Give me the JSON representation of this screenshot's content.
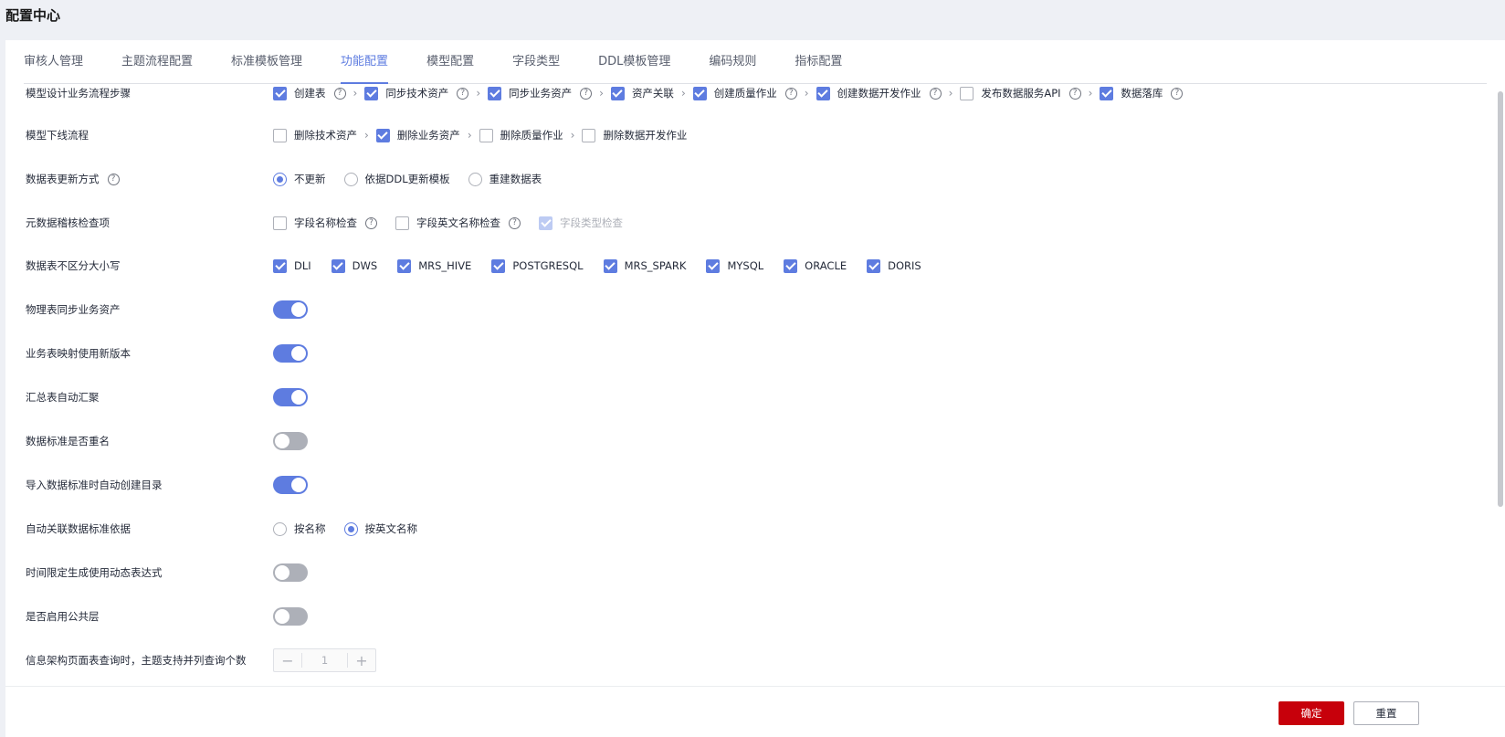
{
  "page_title": "配置中心",
  "tabs": [
    {
      "label": "审核人管理",
      "active": false
    },
    {
      "label": "主题流程配置",
      "active": false
    },
    {
      "label": "标准模板管理",
      "active": false
    },
    {
      "label": "功能配置",
      "active": true
    },
    {
      "label": "模型配置",
      "active": false
    },
    {
      "label": "字段类型",
      "active": false
    },
    {
      "label": "DDL模板管理",
      "active": false
    },
    {
      "label": "编码规则",
      "active": false
    },
    {
      "label": "指标配置",
      "active": false
    }
  ],
  "settings": {
    "model_design_steps": {
      "label": "模型设计业务流程步骤",
      "options": [
        {
          "label": "创建表",
          "checked": true
        },
        {
          "label": "同步技术资产",
          "checked": true
        },
        {
          "label": "同步业务资产",
          "checked": true
        },
        {
          "label": "资产关联",
          "checked": true
        },
        {
          "label": "创建质量作业",
          "checked": true
        },
        {
          "label": "创建数据开发作业",
          "checked": true
        },
        {
          "label": "发布数据服务API",
          "checked": false
        },
        {
          "label": "数据落库",
          "checked": true
        }
      ]
    },
    "model_offline_flow": {
      "label": "模型下线流程",
      "options": [
        {
          "label": "删除技术资产",
          "checked": false
        },
        {
          "label": "删除业务资产",
          "checked": true
        },
        {
          "label": "删除质量作业",
          "checked": false
        },
        {
          "label": "删除数据开发作业",
          "checked": false
        }
      ]
    },
    "table_update_mode": {
      "label": "数据表更新方式",
      "options": [
        {
          "label": "不更新",
          "selected": true
        },
        {
          "label": "依据DDL更新模板",
          "selected": false
        },
        {
          "label": "重建数据表",
          "selected": false
        }
      ]
    },
    "metadata_audit": {
      "label": "元数据稽核检查项",
      "options": [
        {
          "label": "字段名称检查",
          "checked": false
        },
        {
          "label": "字段英文名称检查",
          "checked": false
        },
        {
          "label": "字段类型检查",
          "checked": true,
          "disabled": true
        }
      ]
    },
    "case_insensitive": {
      "label": "数据表不区分大小写",
      "options": [
        {
          "label": "DLI",
          "checked": true
        },
        {
          "label": "DWS",
          "checked": true
        },
        {
          "label": "MRS_HIVE",
          "checked": true
        },
        {
          "label": "POSTGRESQL",
          "checked": true
        },
        {
          "label": "MRS_SPARK",
          "checked": true
        },
        {
          "label": "MYSQL",
          "checked": true
        },
        {
          "label": "ORACLE",
          "checked": true
        },
        {
          "label": "DORIS",
          "checked": true
        }
      ]
    },
    "sync_physical": {
      "label": "物理表同步业务资产",
      "on": true
    },
    "new_mapping": {
      "label": "业务表映射使用新版本",
      "on": true
    },
    "auto_aggregate": {
      "label": "汇总表自动汇聚",
      "on": true
    },
    "standard_rename": {
      "label": "数据标准是否重名",
      "on": false
    },
    "auto_catalog": {
      "label": "导入数据标准时自动创建目录",
      "on": true
    },
    "auto_link_basis": {
      "label": "自动关联数据标准依据",
      "options": [
        {
          "label": "按名称",
          "selected": false
        },
        {
          "label": "按英文名称",
          "selected": true
        }
      ]
    },
    "dynamic_expr": {
      "label": "时间限定生成使用动态表达式",
      "on": false
    },
    "public_layer": {
      "label": "是否启用公共层",
      "on": false
    },
    "parallel_query": {
      "label": "信息架构页面表查询时，主题支持并列查询个数",
      "value": "1"
    }
  },
  "footer": {
    "confirm_label": "确定",
    "reset_label": "重置"
  },
  "colors": {
    "accent": "#5e7ce0",
    "primary_button": "#c7000b"
  },
  "icons": {
    "help": "question-circle-icon",
    "separator": "chevron-right-icon"
  }
}
